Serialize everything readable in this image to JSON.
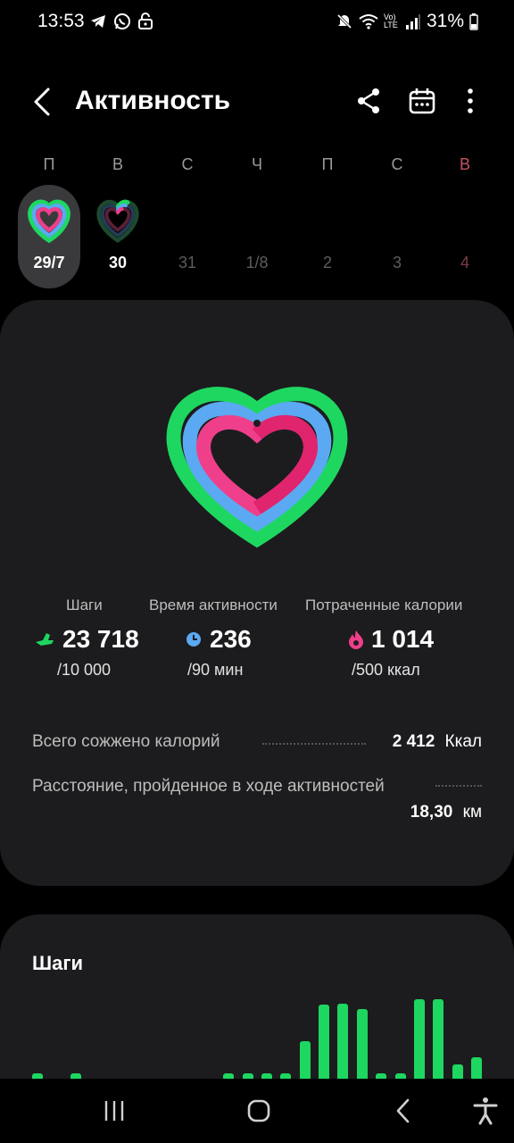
{
  "status": {
    "time": "13:53",
    "battery": "31%",
    "network_label": "Vo) LTE"
  },
  "appbar": {
    "title": "Активность"
  },
  "week": {
    "days": [
      {
        "letter": "П",
        "num": "29/7"
      },
      {
        "letter": "В",
        "num": "30"
      },
      {
        "letter": "С",
        "num": "31"
      },
      {
        "letter": "Ч",
        "num": "1/8"
      },
      {
        "letter": "П",
        "num": "2"
      },
      {
        "letter": "С",
        "num": "3"
      },
      {
        "letter": "В",
        "num": "4"
      }
    ]
  },
  "summary": {
    "steps": {
      "label": "Шаги",
      "value": "23 718",
      "goal": "/10 000"
    },
    "active_time": {
      "label": "Время активности",
      "value": "236",
      "goal": "/90 мин"
    },
    "calories": {
      "label": "Потраченные калории",
      "value": "1 014",
      "goal": "/500 ккал"
    }
  },
  "totals": {
    "burned_label": "Всего сожжено калорий",
    "burned_value": "2 412",
    "burned_unit": "Ккал",
    "distance_label": "Расстояние, пройденное в ходе активностей",
    "distance_value": "18,30",
    "distance_unit": "км"
  },
  "steps_card": {
    "title": "Шаги"
  },
  "colors": {
    "green": "#1ed760",
    "blue": "#5aa9f2",
    "pink": "#ef3f8a",
    "card": "#1c1c1e"
  }
}
